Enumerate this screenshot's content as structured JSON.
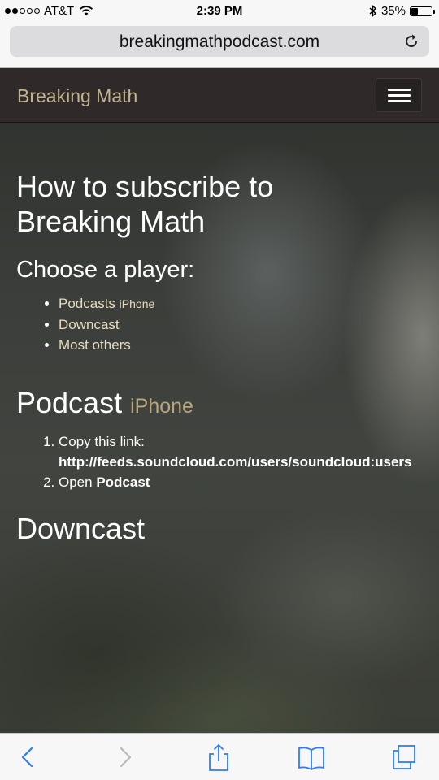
{
  "status_bar": {
    "carrier": "AT&T",
    "time": "2:39 PM",
    "battery_percent": "35%",
    "battery_level": 0.35,
    "signal_bars_filled": 2,
    "signal_bars_total": 5
  },
  "browser": {
    "url": "breakingmathpodcast.com"
  },
  "navbar": {
    "brand": "Breaking Math"
  },
  "content": {
    "title": "How to subscribe to Breaking Math",
    "choose_heading": "Choose a player:",
    "players": [
      {
        "label": "Podcasts",
        "tag": "iPhone"
      },
      {
        "label": "Downcast",
        "tag": ""
      },
      {
        "label": "Most others",
        "tag": ""
      }
    ],
    "podcast_section": {
      "title": "Podcast",
      "tag": "iPhone",
      "steps": [
        {
          "text": "Copy this link:",
          "link": "http://feeds.soundcloud.com/users/soundcloud:users"
        },
        {
          "text": "Open",
          "bold": "Podcast"
        }
      ]
    },
    "downcast_section": {
      "title": "Downcast"
    }
  },
  "colors": {
    "accent": "#c2b391",
    "ios_blue": "#2f7cf6",
    "navbar_bg": "#2f2a29"
  }
}
